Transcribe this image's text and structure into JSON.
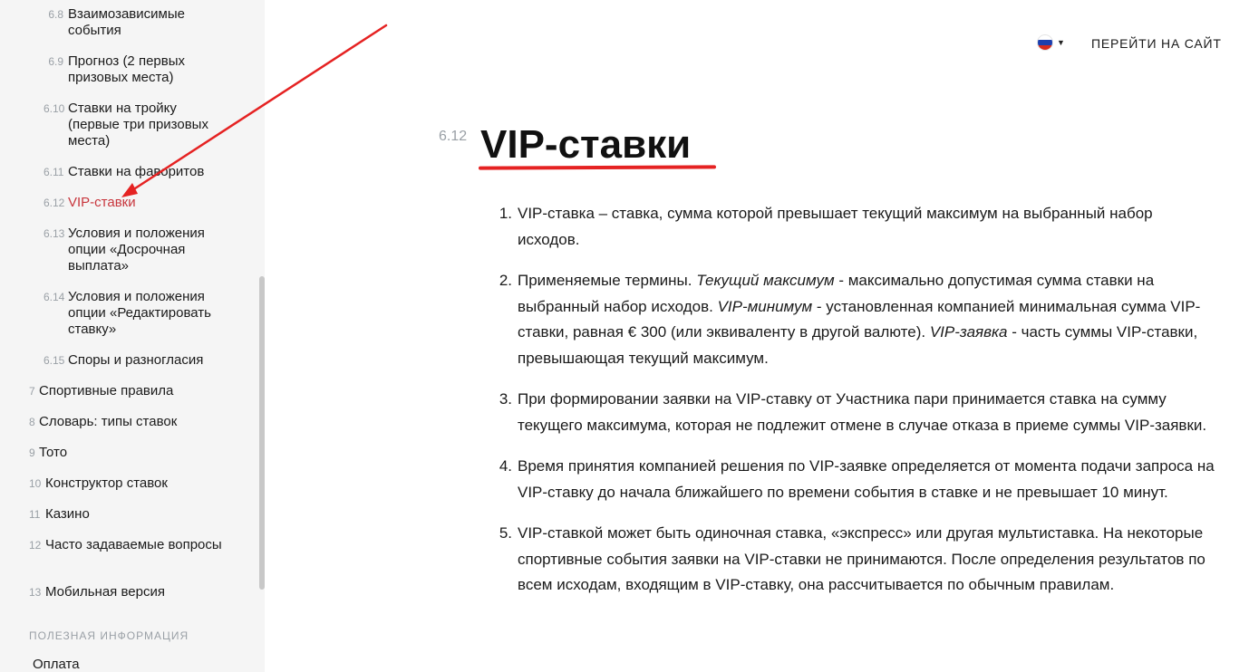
{
  "sidebar": {
    "sub_items": [
      {
        "num": "6.8",
        "label": "Взаимозависимые события",
        "active": false
      },
      {
        "num": "6.9",
        "label": "Прогноз (2 первых призовых места)",
        "active": false
      },
      {
        "num": "6.10",
        "label": "Ставки на тройку (первые три призовых места)",
        "active": false
      },
      {
        "num": "6.11",
        "label": "Ставки на фаворитов",
        "active": false
      },
      {
        "num": "6.12",
        "label": "VIP-ставки",
        "active": true
      },
      {
        "num": "6.13",
        "label": "Условия и положения опции «Досрочная выплата»",
        "active": false
      },
      {
        "num": "6.14",
        "label": "Условия и положения опции «Редактировать ставку»",
        "active": false
      },
      {
        "num": "6.15",
        "label": "Споры и разногласия",
        "active": false
      }
    ],
    "top_items": [
      {
        "num": "7",
        "label": "Спортивные правила"
      },
      {
        "num": "8",
        "label": "Словарь: типы ставок"
      },
      {
        "num": "9",
        "label": "Тото"
      },
      {
        "num": "10",
        "label": "Конструктор ставок"
      },
      {
        "num": "11",
        "label": "Казино"
      },
      {
        "num": "12",
        "label": "Часто задаваемые вопросы"
      },
      {
        "num": "13",
        "label": "Мобильная версия"
      }
    ],
    "section_title": "ПОЛЕЗНАЯ ИНФОРМАЦИЯ",
    "useful_items": [
      "Оплата"
    ]
  },
  "header": {
    "language_flag": "russia-flag-icon",
    "goto_site": "ПЕРЕЙТИ НА САЙТ"
  },
  "article": {
    "number": "6.12",
    "title": "VIP-ставки",
    "rules": [
      {
        "num": "1.",
        "parts": [
          {
            "text": "VIP-ставка – ставка, сумма которой превышает текущий максимум на выбранный набор исходов.",
            "italic": false
          }
        ]
      },
      {
        "num": "2.",
        "parts": [
          {
            "text": "Применяемые термины. ",
            "italic": false
          },
          {
            "text": "Текущий максимум",
            "italic": true
          },
          {
            "text": " - максимально допустимая сумма ставки на выбранный набор исходов. ",
            "italic": false
          },
          {
            "text": "VIP-минимум",
            "italic": true
          },
          {
            "text": " - установленная компанией минимальная сумма VIP-ставки, равная € 300 (или эквиваленту в другой валюте). ",
            "italic": false
          },
          {
            "text": "VIP-заявка",
            "italic": true
          },
          {
            "text": " - часть суммы VIP-ставки, превышающая текущий максимум.",
            "italic": false
          }
        ]
      },
      {
        "num": "3.",
        "parts": [
          {
            "text": "При формировании заявки на VIP-ставку от Участника пари принимается ставка на сумму текущего максимума, которая не подлежит отмене в случае отказа в приеме суммы VIP-заявки.",
            "italic": false
          }
        ]
      },
      {
        "num": "4.",
        "parts": [
          {
            "text": "Время принятия компанией решения по VIP-заявке определяется от момента подачи запроса на VIP-ставку до начала ближайшего по времени события в ставке и не превышает 10 минут.",
            "italic": false
          }
        ]
      },
      {
        "num": "5.",
        "parts": [
          {
            "text": "VIP-ставкой может быть одиночная ставка, «экспресс» или другая мультиставка. На некоторые спортивные события заявки на VIP-ставки не принимаются. После определения результатов по всем исходам, входящим в VIP-ставку, она рассчитывается по обычным правилам.",
            "italic": false
          }
        ]
      }
    ]
  },
  "colors": {
    "active_link": "#c8363d",
    "annotation_red": "#e52222",
    "sidebar_bg": "#f5f5f5",
    "muted_number": "#9aa0a6"
  }
}
